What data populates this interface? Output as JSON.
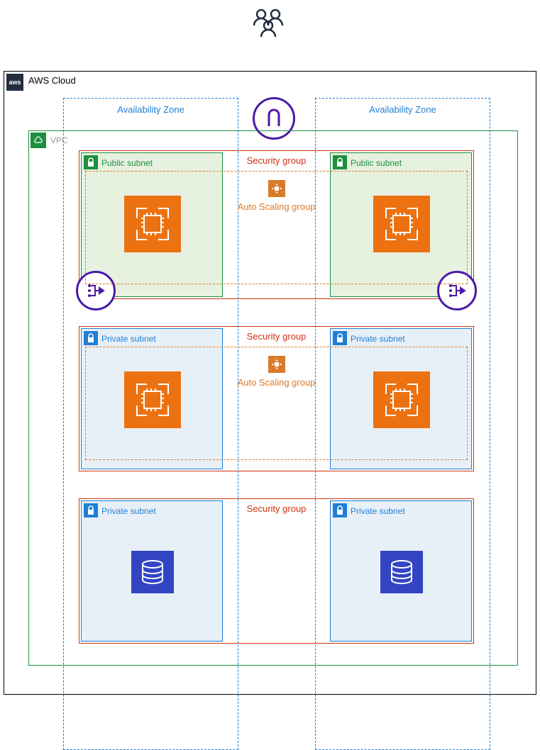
{
  "diagram": {
    "users_icon": "users-group-icon",
    "cloud": {
      "label": "AWS Cloud",
      "logo": "aws"
    },
    "availability_zones": [
      {
        "label": "Availability Zone"
      },
      {
        "label": "Availability Zone"
      }
    ],
    "gateway": {
      "name": "internet-gateway"
    },
    "vpc": {
      "label": "VPC"
    },
    "tiers": [
      {
        "security_group_label": "Security group",
        "auto_scaling_label": "Auto Scaling group",
        "subnet_type": "public",
        "subnet_left_label": "Public subnet",
        "subnet_right_label": "Public subnet",
        "instance": "ec2",
        "has_nat": true
      },
      {
        "security_group_label": "Security group",
        "auto_scaling_label": "Auto Scaling group",
        "subnet_type": "private",
        "subnet_left_label": "Private subnet",
        "subnet_right_label": "Private subnet",
        "instance": "ec2",
        "has_nat": false
      },
      {
        "security_group_label": "Security group",
        "subnet_type": "private",
        "subnet_left_label": "Private subnet",
        "subnet_right_label": "Private subnet",
        "instance": "database",
        "has_nat": false
      }
    ]
  },
  "colors": {
    "aws_dark": "#232f3e",
    "az_blue": "#1f7fd6",
    "vpc_green": "#1e8f3e",
    "sg_red": "#d13212",
    "asg_orange": "#d87b2b",
    "ec2_orange": "#ec7211",
    "purple": "#4a1aa6",
    "db_blue": "#3344c3"
  }
}
